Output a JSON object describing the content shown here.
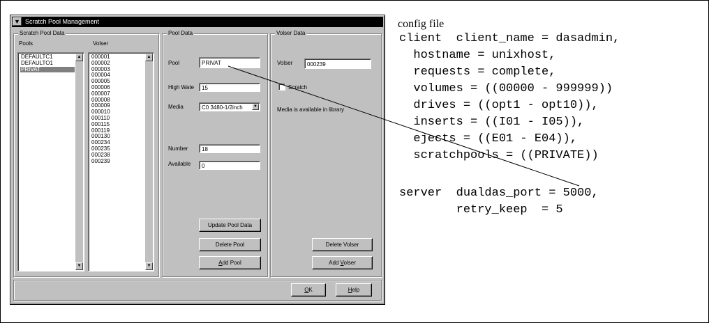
{
  "window": {
    "title": "Scratch Pool Management",
    "system_menu_icon": "chevron-down-icon"
  },
  "scratch_pool_data": {
    "group_label": "Scratch Pool Data",
    "pools_header": "Pools",
    "volser_header": "Volser",
    "pools": [
      {
        "label": "DEFAULTC1",
        "selected": false
      },
      {
        "label": "DEFAULTO1",
        "selected": false
      },
      {
        "label": "PRIVAT",
        "selected": true
      }
    ],
    "volsers": [
      "000001",
      "000002",
      "000003",
      "000004",
      "000005",
      "000006",
      "000007",
      "000008",
      "000009",
      "000010",
      "000110",
      "000115",
      "000119",
      "000130",
      "000234",
      "000235",
      "000238",
      "000239"
    ]
  },
  "pool_data": {
    "group_label": "Pool Data",
    "pool_label": "Pool",
    "pool_value": "PRIVAT",
    "high_water_label": "High Wate",
    "high_water_value": "15",
    "media_label": "Media",
    "media_value": "C0  3480-1/2inch",
    "number_label": "Number",
    "number_value": "18",
    "available_label": "Available",
    "available_value": "0",
    "update_button": "Update Pool Data",
    "delete_button": "Delete Pool",
    "add_button_prefix": "A",
    "add_button_rest": "dd Pool"
  },
  "volser_data": {
    "group_label": "Volser Data",
    "volser_label": "Volser",
    "volser_value": "000239",
    "scratch_label": "Scratch",
    "scratch_checked": false,
    "status_text": "Media is available in library",
    "delete_button": "Delete Volser",
    "add_button_prefix": "Add ",
    "add_button_mnemonic": "V",
    "add_button_rest": "olser"
  },
  "footer": {
    "ok_mnemonic": "O",
    "ok_rest": "K",
    "help_mnemonic": "H",
    "help_rest": "elp"
  },
  "config": {
    "title": "config file",
    "lines": [
      "client  client_name = dasadmin,",
      "  hostname = unixhost,",
      "  requests = complete,",
      "  volumes = ((00000 - 999999))",
      "  drives = ((opt1 - opt10)),",
      "  inserts = ((I01 - I05)),",
      "  ejects = ((E01 - E04)),",
      "  scratchpools = ((PRIVATE))",
      "",
      "server  dualdas_port = 5000,",
      "        retry_keep  = 5"
    ]
  }
}
